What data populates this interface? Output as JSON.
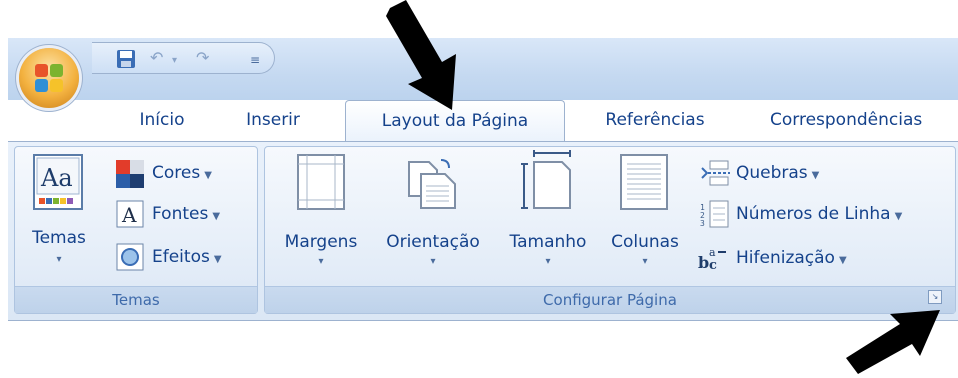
{
  "qat": {
    "save_icon": "save-icon",
    "undo_icon": "undo-icon",
    "redo_icon": "redo-icon",
    "customize_icon": "customize-qat-icon"
  },
  "tabs": [
    {
      "label": "Início",
      "active": false
    },
    {
      "label": "Inserir",
      "active": false
    },
    {
      "label": "Layout da Página",
      "active": true
    },
    {
      "label": "Referências",
      "active": false
    },
    {
      "label": "Correspondências",
      "active": false
    }
  ],
  "groups": {
    "temas": {
      "label": "Temas",
      "big_button": "Temas",
      "items": [
        {
          "label": "Cores",
          "icon": "colors-icon"
        },
        {
          "label": "Fontes",
          "icon": "fonts-icon"
        },
        {
          "label": "Efeitos",
          "icon": "effects-icon"
        }
      ]
    },
    "configurar": {
      "label": "Configurar Página",
      "big_buttons": [
        {
          "label": "Margens",
          "icon": "margins-icon"
        },
        {
          "label": "Orientação",
          "icon": "orientation-icon"
        },
        {
          "label": "Tamanho",
          "icon": "size-icon"
        },
        {
          "label": "Colunas",
          "icon": "columns-icon"
        }
      ],
      "items": [
        {
          "label": "Quebras",
          "icon": "breaks-icon"
        },
        {
          "label": "Números de Linha",
          "icon": "line-numbers-icon"
        },
        {
          "label": "Hifenização",
          "icon": "hyphenation-icon"
        }
      ]
    }
  },
  "colors": {
    "accent_text": "#15428b",
    "ribbon_background": "#dbe7f5",
    "arrow": "#000000"
  }
}
